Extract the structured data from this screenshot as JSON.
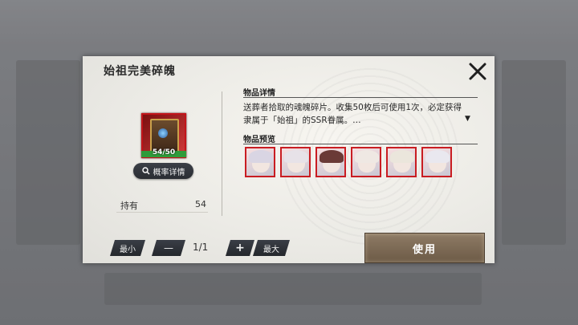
{
  "dialog": {
    "title": "始祖完美碎魄",
    "close_icon": "close-icon"
  },
  "item": {
    "count_text": "54/50",
    "progress": 1.0,
    "icon": "book-soul-icon",
    "prob_button_label": "概率详情",
    "prob_icon": "search-icon",
    "hold_label": "持有",
    "hold_value": "54"
  },
  "details": {
    "header": "物品详情",
    "description": "送葬者拾取的魂魄碎片。收集50枚后可使用1次，必定获得隶属于「始祖」的SSR眷属。…",
    "more_icon": "triangle-down-icon"
  },
  "preview": {
    "header": "物品预览",
    "characters": [
      {
        "name": "character-1",
        "hair": "#d9d5e3"
      },
      {
        "name": "character-2",
        "hair": "#e7e2e8"
      },
      {
        "name": "character-3",
        "hair": "#6a3a36"
      },
      {
        "name": "character-4",
        "hair": "#efe8e3"
      },
      {
        "name": "character-5",
        "hair": "#ebe6dc"
      },
      {
        "name": "character-6",
        "hair": "#e9e8ef"
      }
    ]
  },
  "quantity": {
    "min_label": "最小",
    "minus_label": "—",
    "value": "1/1",
    "plus_label": "+",
    "max_label": "最大"
  },
  "use_button_label": "使用",
  "colors": {
    "accent_red": "#c91d22",
    "button_dark": "#2a2d33",
    "use_button": "#7d6a55"
  }
}
